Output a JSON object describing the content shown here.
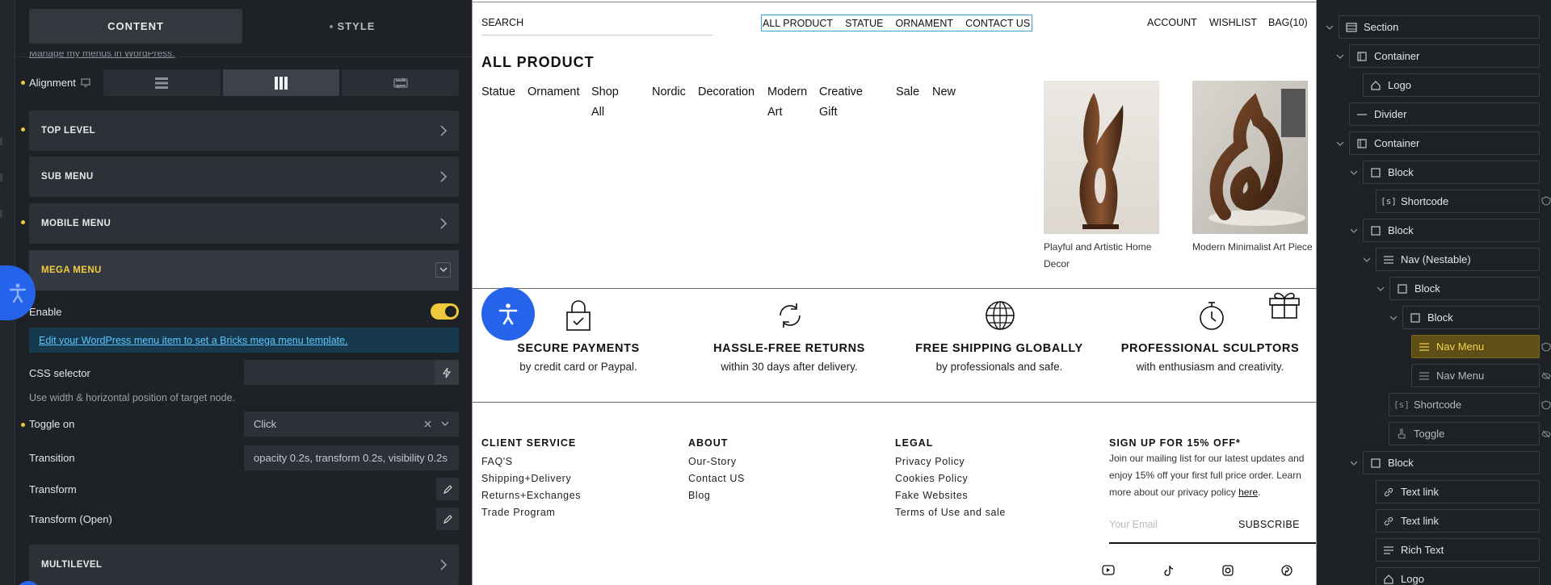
{
  "left_panel": {
    "tabs": {
      "content": "CONTENT",
      "style": "STYLE"
    },
    "cut_text": "Manage my menus in WordPress.",
    "alignment_label": "Alignment",
    "sections": {
      "top_level": "TOP LEVEL",
      "sub_menu": "SUB MENU",
      "mobile_menu": "MOBILE MENU",
      "mega_menu": "MEGA MENU",
      "multilevel": "MULTILEVEL"
    },
    "enable_label": "Enable",
    "enable_on": true,
    "info_link": "Edit your WordPress menu item to set a Bricks mega menu template.",
    "css_selector_label": "CSS selector",
    "css_selector_value": "",
    "hint": "Use width & horizontal position of target node.",
    "toggle_on_label": "Toggle on",
    "toggle_on_value": "Click",
    "transition_label": "Transition",
    "transition_value": "opacity 0.2s, transform 0.2s, visibility 0.2s",
    "transform_label": "Transform",
    "transform_open_label": "Transform (Open)"
  },
  "canvas": {
    "search": "SEARCH",
    "nav": [
      "ALL PRODUCT",
      "STATUE",
      "ORNAMENT",
      "CONTACT US"
    ],
    "account": "ACCOUNT",
    "wishlist": "WISHLIST",
    "bag": "BAG(10)",
    "mega_title": "ALL PRODUCT",
    "categories": [
      "Statue",
      "Ornament",
      "Shop All",
      "Nordic",
      "Decoration",
      "Modern Art",
      "Creative Gift",
      "Sale",
      "New"
    ],
    "products": [
      {
        "caption": "Playful and Artistic Home Decor"
      },
      {
        "caption": "Modern Minimalist Art Piece"
      }
    ],
    "features": [
      {
        "icon": "lock-check-icon",
        "title": "SECURE PAYMENTS",
        "sub": "by credit card or Paypal."
      },
      {
        "icon": "refresh-icon",
        "title": "HASSLE-FREE RETURNS",
        "sub": "within 30 days after delivery."
      },
      {
        "icon": "globe-icon",
        "title": "FREE SHIPPING GLOBALLY",
        "sub": "by professionals and safe."
      },
      {
        "icon": "stopwatch-icon",
        "title": "PROFESSIONAL SCULPTORS",
        "sub": "with enthusiasm and creativity."
      }
    ],
    "footer": {
      "client_service": {
        "title": "CLIENT SERVICE",
        "links": [
          "FAQ'S",
          "Shipping+Delivery",
          "Returns+Exchanges",
          "Trade Program"
        ]
      },
      "about": {
        "title": "ABOUT",
        "links": [
          "Our-Story",
          "Contact US",
          "Blog"
        ]
      },
      "legal": {
        "title": "LEGAL",
        "links": [
          "Privacy Policy",
          "Cookies Policy",
          "Fake Websites",
          "Terms of Use and sale"
        ]
      },
      "signup": {
        "title": "SIGN UP FOR 15% OFF*",
        "text": "Join our mailing list for our latest updates and enjoy 15% off your first full price order. Learn more about our privacy policy",
        "link": "here",
        "email_placeholder": "Your Email",
        "subscribe": "SUBSCRIBE"
      }
    }
  },
  "structure": {
    "nodes": [
      "Section",
      "Container",
      "Logo",
      "Divider",
      "Container",
      "Block",
      "Shortcode",
      "Block",
      "Nav (Nestable)",
      "Block",
      "Block",
      "Nav Menu",
      "Nav Menu",
      "Shortcode",
      "Toggle",
      "Block",
      "Text link",
      "Text link",
      "Rich Text",
      "Logo"
    ]
  },
  "colors": {
    "accent": "#f0c93a",
    "link_blue": "#5ec6ff",
    "brand_blue": "#2563eb"
  }
}
